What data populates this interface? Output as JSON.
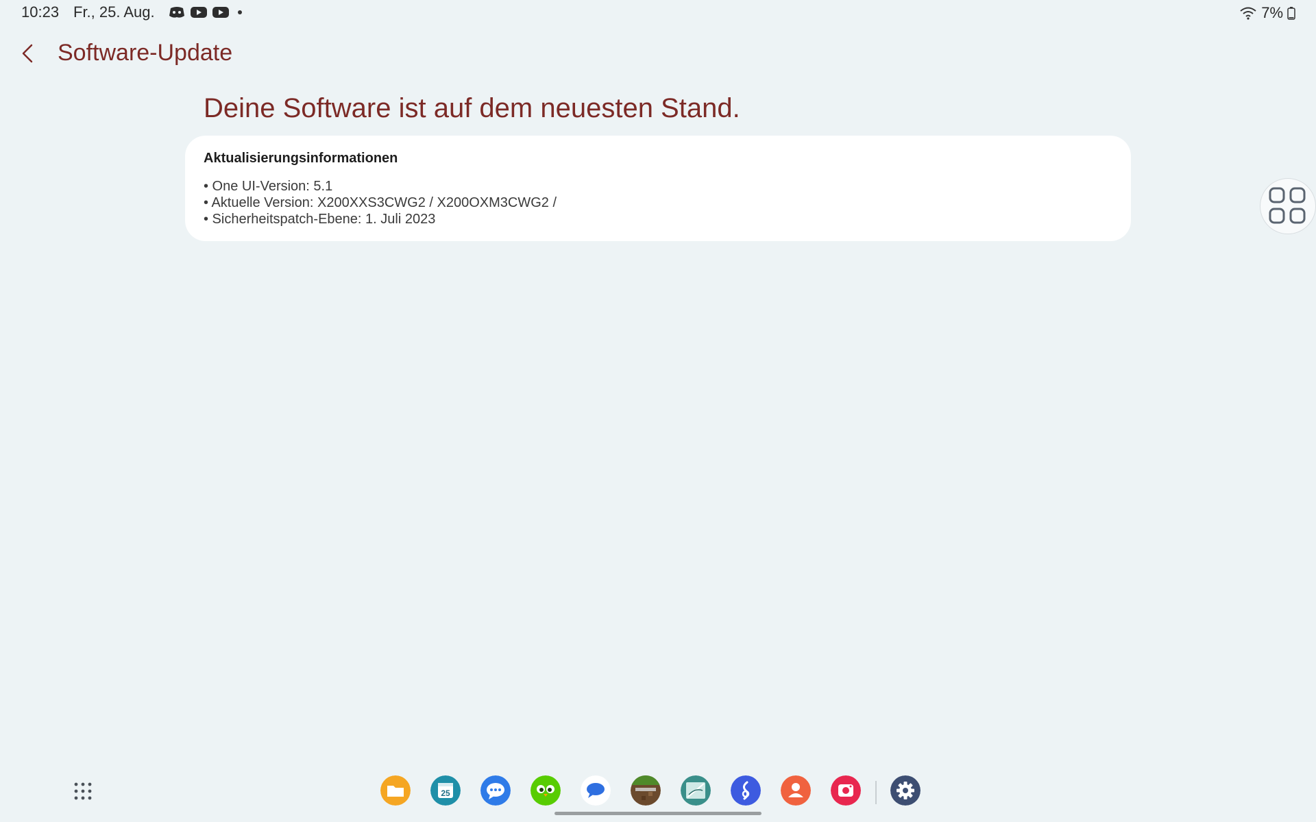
{
  "status_bar": {
    "time": "10:23",
    "date": "Fr., 25. Aug.",
    "notification_icons": [
      "discord-icon",
      "youtube-icon",
      "youtube-icon"
    ],
    "battery_text": "7%",
    "wifi_icon": "wifi-icon",
    "battery_icon": "battery-icon"
  },
  "header": {
    "back_icon": "chevron-left-icon",
    "title": "Software-Update"
  },
  "main": {
    "headline": "Deine Software ist auf dem neuesten Stand.",
    "card": {
      "title": "Aktualisierungsinformationen",
      "items": [
        "• One UI-Version: 5.1",
        "• Aktuelle Version: X200XXS3CWG2 / X200OXM3CWG2 /",
        "• Sicherheitspatch-Ebene: 1. Juli 2023"
      ]
    }
  },
  "edge_panel": {
    "icon": "grid-four-icon"
  },
  "taskbar": {
    "apps_icon": "apps-grid-icon",
    "dock": [
      {
        "name": "files-icon",
        "color": "#f5a623"
      },
      {
        "name": "calendar-icon",
        "color": "#1f8fa8",
        "label": "25"
      },
      {
        "name": "messages-icon",
        "color": "#2f7be8"
      },
      {
        "name": "duolingo-icon",
        "color": "#58cc02"
      },
      {
        "name": "chat-bubble-icon",
        "color": "#2f6fe0"
      },
      {
        "name": "minecraft-icon",
        "color": "#6b4a2d"
      },
      {
        "name": "notes-icon",
        "color": "#3a8f8a"
      },
      {
        "name": "link-icon",
        "color": "#3d5be0"
      },
      {
        "name": "contacts-icon",
        "color": "#f0623f"
      },
      {
        "name": "screen-recorder-icon",
        "color": "#e8274f"
      },
      {
        "name": "settings-gear-icon",
        "color": "#3d4e72"
      }
    ]
  },
  "colors": {
    "accent": "#7c2a26",
    "background": "#edf3f5",
    "card": "#ffffff"
  }
}
